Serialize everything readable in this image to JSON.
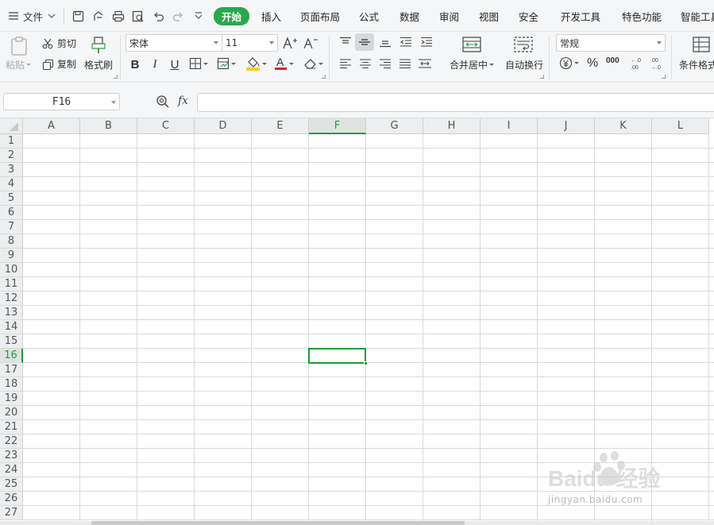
{
  "menubar": {
    "file_label": "文件",
    "tabs": [
      "开始",
      "插入",
      "页面布局",
      "公式",
      "数据",
      "审阅",
      "视图",
      "安全",
      "开发工具",
      "特色功能",
      "智能工具"
    ]
  },
  "ribbon": {
    "paste_label": "粘贴",
    "cut_label": "剪切",
    "copy_label": "复制",
    "format_painter_label": "格式刷",
    "font_name": "宋体",
    "font_size": "11",
    "merge_center_label": "合并居中",
    "wrap_text_label": "自动换行",
    "number_format": "常规",
    "conditional_format_label": "条件格式",
    "percent_symbol": "%",
    "thousands_symbol": "000",
    "increase_decimal": "+.0 .00",
    "decrease_decimal": ".00 →.0"
  },
  "formula_bar": {
    "cell_reference": "F16",
    "fx_label": "fx",
    "formula_value": ""
  },
  "sheet": {
    "columns": [
      "A",
      "B",
      "C",
      "D",
      "E",
      "F",
      "G",
      "H",
      "I",
      "J",
      "K",
      "L"
    ],
    "rows": [
      "1",
      "2",
      "3",
      "4",
      "5",
      "6",
      "7",
      "8",
      "9",
      "10",
      "11",
      "12",
      "13",
      "14",
      "15",
      "16",
      "17",
      "18",
      "19",
      "20",
      "21",
      "22",
      "23",
      "24",
      "25",
      "26",
      "27"
    ],
    "selected_column": "F",
    "selected_row": "16"
  },
  "watermark": {
    "brand": "Baidu 经验",
    "url": "jingyan.baidu.com"
  },
  "colors": {
    "accent_green": "#1e9b3a",
    "home_tab_bg": "#2aa84a",
    "toolbar_bg": "#f5f6f7",
    "font_color_bar": "#e02020",
    "fill_color_bar": "#f2d21b"
  }
}
